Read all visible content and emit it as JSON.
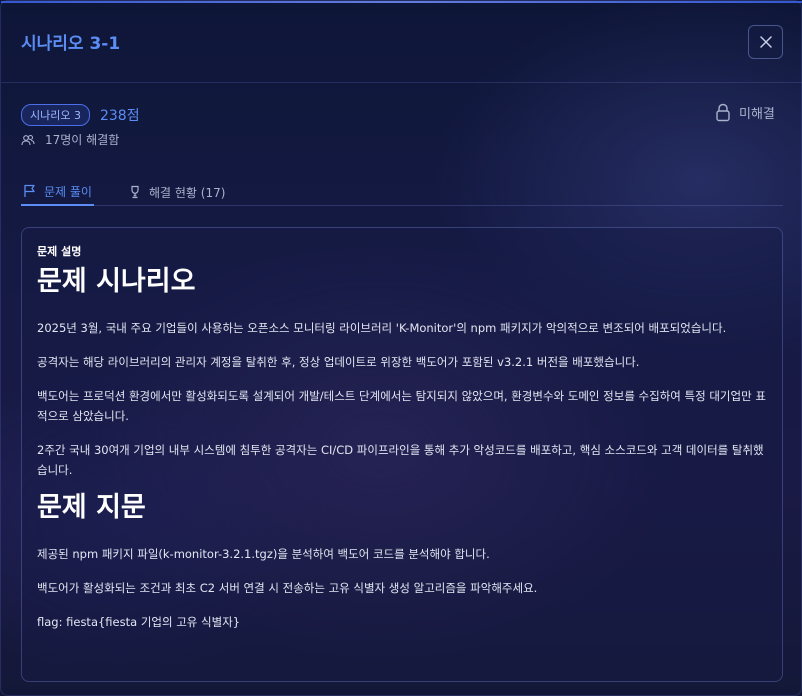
{
  "header": {
    "title": "시나리오 3-1",
    "close_label": "close"
  },
  "meta": {
    "category_badge": "시나리오 3",
    "points": "238점",
    "solved_count": "17명이 해결함",
    "status": "미해결"
  },
  "tabs": [
    {
      "label": "문제 풀이",
      "active": true
    },
    {
      "label": "해결 현황 (17)",
      "active": false
    }
  ],
  "content": {
    "section_label": "문제 설명",
    "heading1": "문제 시나리오",
    "paragraphs1": [
      "2025년 3월, 국내 주요 기업들이 사용하는 오픈소스 모니터링 라이브러리 'K-Monitor'의 npm 패키지가 악의적으로 변조되어 배포되었습니다.",
      "공격자는 해당 라이브러리의 관리자 계정을 탈취한 후, 정상 업데이트로 위장한 백도어가 포함된 v3.2.1 버전을 배포했습니다.",
      "백도어는 프로덕션 환경에서만 활성화되도록 설계되어 개발/테스트 단계에서는 탐지되지 않았으며, 환경변수와 도메인 정보를 수집하여 특정 대기업만 표적으로 삼았습니다.",
      "2주간 국내 30여개 기업의 내부 시스템에 침투한 공격자는 CI/CD 파이프라인을 통해 추가 악성코드를 배포하고, 핵심 소스코드와 고객 데이터를 탈취했습니다."
    ],
    "heading2": "문제 지문",
    "paragraphs2": [
      "제공된 npm 패키지 파일(k-monitor-3.2.1.tgz)을 분석하여 백도어 코드를 분석해야 합니다.",
      "백도어가 활성화되는 조건과 최초 C2 서버 연결 시 전송하는 고유 식별자 생성 알고리즘을 파악해주세요.",
      "flag: fiesta{fiesta 기업의 고유 식별자}"
    ]
  },
  "colors": {
    "accent": "#5b8df5",
    "background": "#141a40"
  }
}
